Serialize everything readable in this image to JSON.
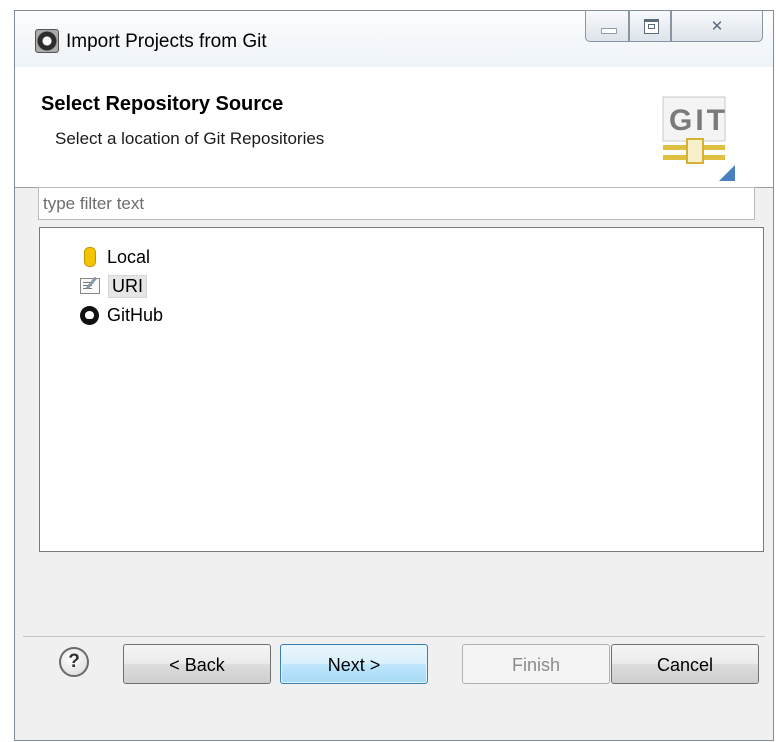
{
  "window": {
    "title": "Import Projects from Git",
    "buttons": {
      "minimize": "",
      "maximize": "",
      "close": "✕"
    }
  },
  "header": {
    "title": "Select Repository Source",
    "description": "Select a location of Git Repositories",
    "logo_text": "GIT"
  },
  "filter": {
    "placeholder": "type filter text",
    "value": ""
  },
  "tree": {
    "items": [
      {
        "label": "Local",
        "icon": "repository-icon",
        "selected": false
      },
      {
        "label": "URI",
        "icon": "uri-edit-icon",
        "selected": true
      },
      {
        "label": "GitHub",
        "icon": "github-icon",
        "selected": false
      }
    ]
  },
  "footer": {
    "help": "?",
    "back": "< Back",
    "next": "Next >",
    "finish": "Finish",
    "cancel": "Cancel"
  }
}
